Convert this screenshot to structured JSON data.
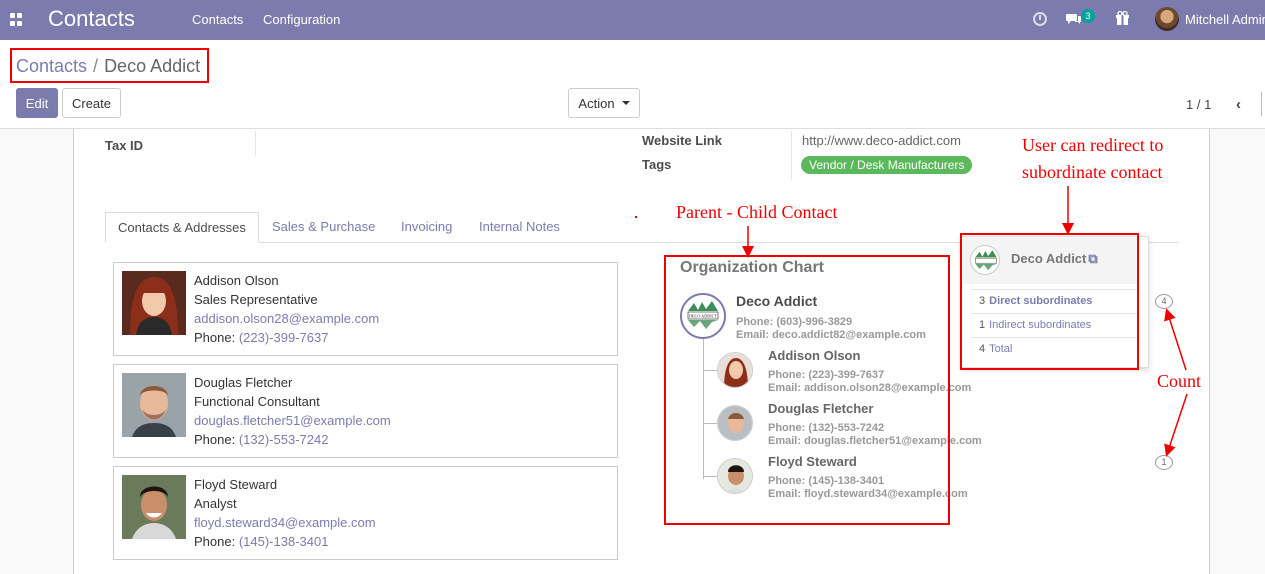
{
  "navbar": {
    "brand": "Contacts",
    "menu": [
      "Contacts",
      "Configuration"
    ],
    "chat_count": "3",
    "user_name": "Mitchell Admin"
  },
  "breadcrumb": {
    "parent": "Contacts",
    "separator": "/",
    "current": "Deco Addict"
  },
  "buttons": {
    "edit": "Edit",
    "create": "Create",
    "action": "Action"
  },
  "pager": {
    "value": "1 / 1"
  },
  "form": {
    "tax_id_label": "Tax ID",
    "website_label": "Website Link",
    "website_value": "http://www.deco-addict.com",
    "tags_label": "Tags",
    "tag": "Vendor / Desk Manufacturers"
  },
  "tabs": [
    "Contacts & Addresses",
    "Sales & Purchase",
    "Invoicing",
    "Internal Notes"
  ],
  "contacts": [
    {
      "name": "Addison Olson",
      "function": "Sales Representative",
      "email": "addison.olson28@example.com",
      "phone_label": "Phone:",
      "phone": "(223)-399-7637"
    },
    {
      "name": "Douglas Fletcher",
      "function": "Functional Consultant",
      "email": "douglas.fletcher51@example.com",
      "phone_label": "Phone:",
      "phone": "(132)-553-7242"
    },
    {
      "name": "Floyd Steward",
      "function": "Analyst",
      "email": "floyd.steward34@example.com",
      "phone_label": "Phone:",
      "phone": "(145)-138-3401"
    }
  ],
  "org_chart": {
    "title": "Organization Chart",
    "main": {
      "name": "Deco Addict",
      "phone": "Phone: (603)-996-3829",
      "email": "Email: deco.addict82@example.com"
    },
    "children": [
      {
        "name": "Addison Olson",
        "phone": "Phone: (223)-399-7637",
        "email": "Email: addison.olson28@example.com"
      },
      {
        "name": "Douglas Fletcher",
        "phone": "Phone: (132)-553-7242",
        "email": "Email: douglas.fletcher51@example.com"
      },
      {
        "name": "Floyd Steward",
        "phone": "Phone: (145)-138-3401",
        "email": "Email: floyd.steward34@example.com"
      }
    ]
  },
  "popover": {
    "name": "Deco Addict",
    "rows": [
      {
        "count": "3",
        "label": "Direct subordinates"
      },
      {
        "count": "1",
        "label": "Indirect subordinates"
      },
      {
        "count": "4",
        "label": "Total"
      }
    ],
    "circle_counts": [
      "4",
      "1"
    ]
  },
  "annotations": {
    "parent_child": "Parent - Child Contact",
    "redirect_line1": "User can redirect to",
    "redirect_line2": "subordinate contact",
    "count": "Count"
  },
  "colors": {
    "navbar": "#7c7bad",
    "accent": "#7c7bad",
    "tag": "#5cb85c",
    "annotation": "#e00000",
    "badge": "#00a09d"
  }
}
